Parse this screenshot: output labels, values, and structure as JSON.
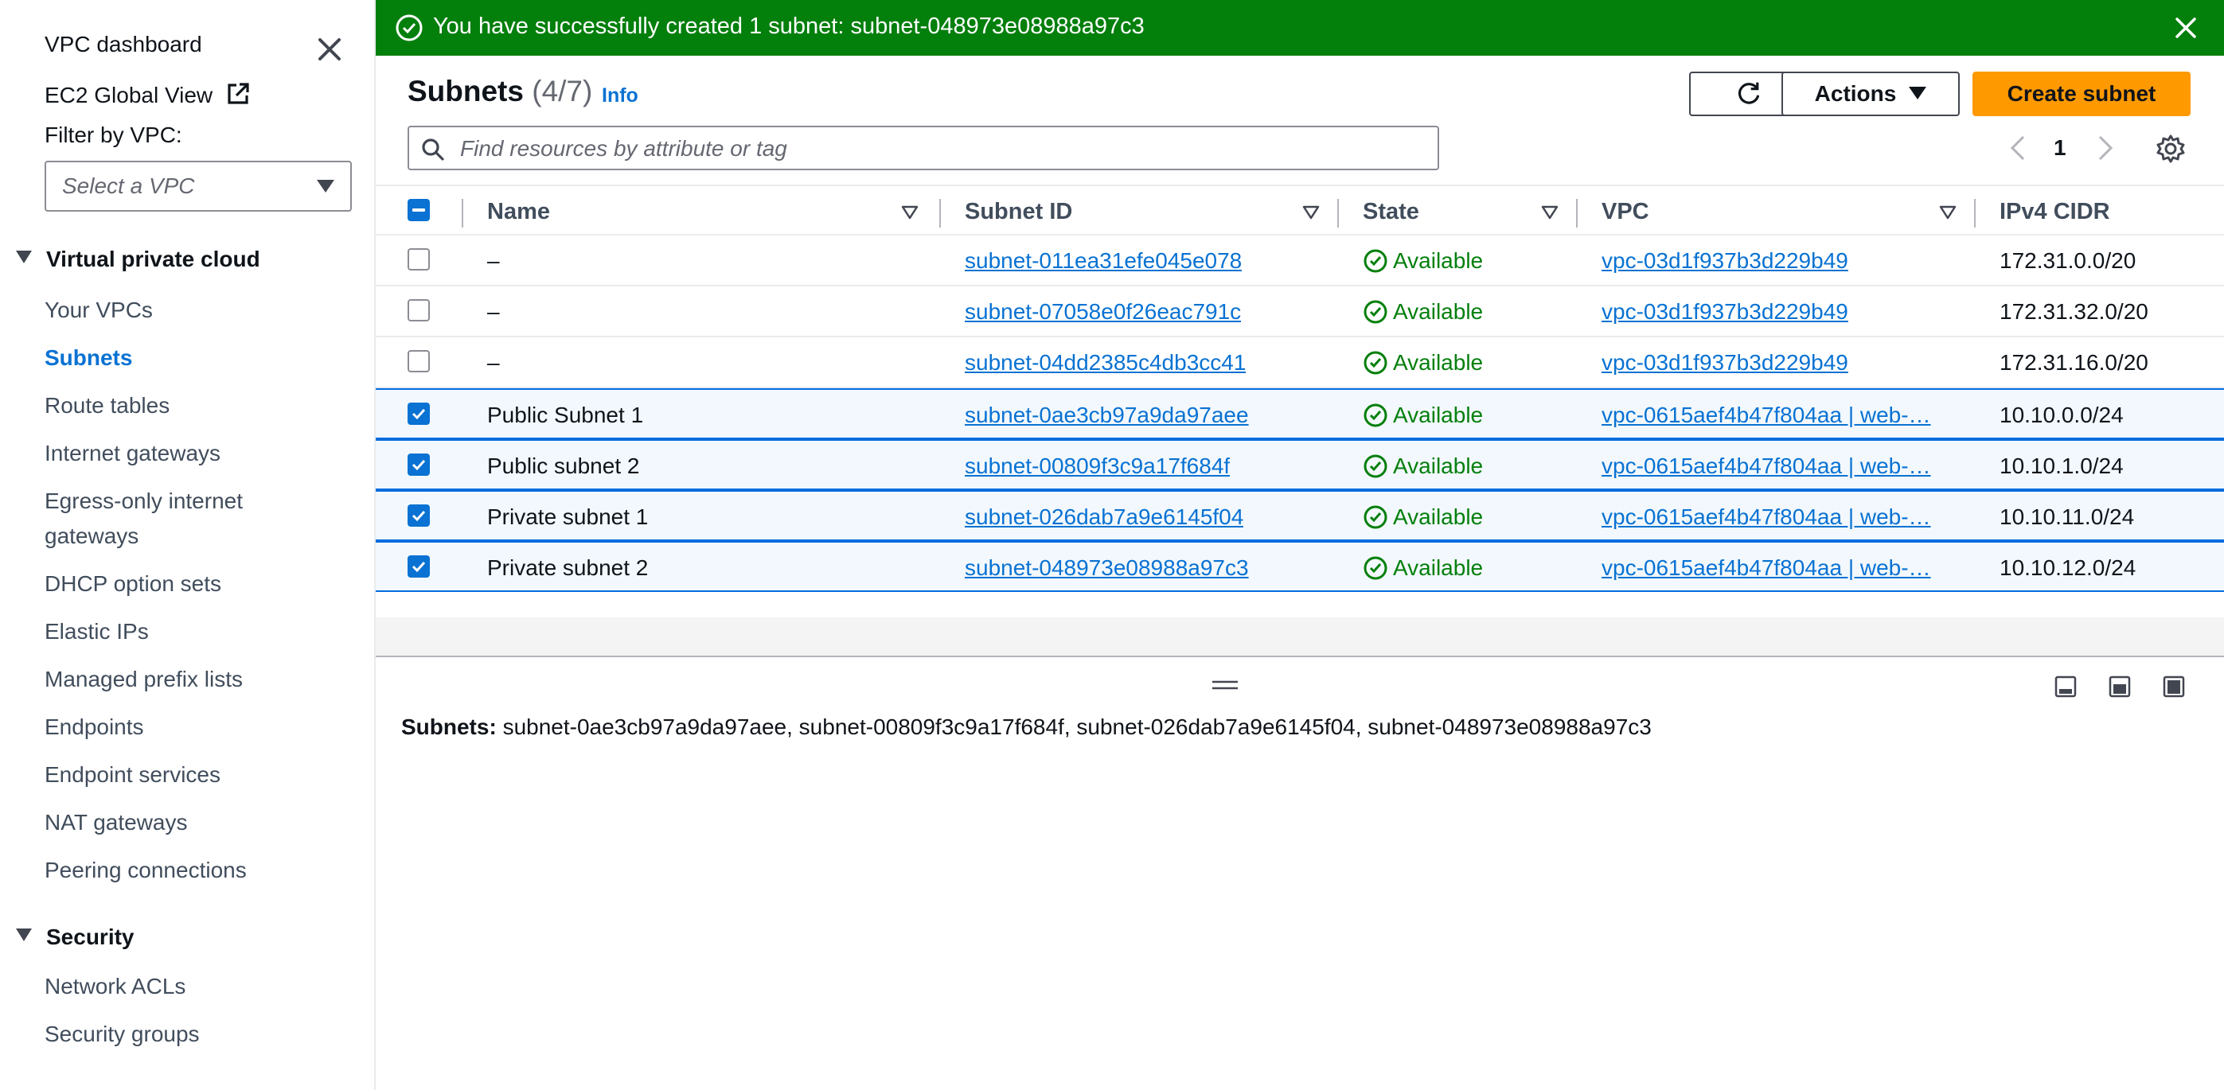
{
  "sidebar": {
    "dashboard": "VPC dashboard",
    "global_view": "EC2 Global View",
    "filter_label": "Filter by VPC:",
    "filter_placeholder": "Select a VPC",
    "sections": [
      {
        "title": "Virtual private cloud",
        "items": [
          "Your VPCs",
          "Subnets",
          "Route tables",
          "Internet gateways",
          "Egress-only internet gateways",
          "DHCP option sets",
          "Elastic IPs",
          "Managed prefix lists",
          "Endpoints",
          "Endpoint services",
          "NAT gateways",
          "Peering connections"
        ],
        "active": "Subnets"
      },
      {
        "title": "Security",
        "items": [
          "Network ACLs",
          "Security groups"
        ]
      }
    ]
  },
  "flash": {
    "message": "You have successfully created 1 subnet: subnet-048973e08988a97c3",
    "type": "success"
  },
  "header": {
    "title": "Subnets",
    "count": "(4/7)",
    "info": "Info",
    "actions": "Actions",
    "create": "Create subnet"
  },
  "search": {
    "placeholder": "Find resources by attribute or tag",
    "value": ""
  },
  "pagination": {
    "page": "1"
  },
  "table": {
    "columns": [
      "Name",
      "Subnet ID",
      "State",
      "VPC",
      "IPv4 CIDR"
    ],
    "rows": [
      {
        "name": "–",
        "subnet_id": "subnet-011ea31efe045e078",
        "state": "Available",
        "vpc": "vpc-03d1f937b3d229b49",
        "cidr": "172.31.0.0/20",
        "selected": false
      },
      {
        "name": "–",
        "subnet_id": "subnet-07058e0f26eac791c",
        "state": "Available",
        "vpc": "vpc-03d1f937b3d229b49",
        "cidr": "172.31.32.0/20",
        "selected": false
      },
      {
        "name": "–",
        "subnet_id": "subnet-04dd2385c4db3cc41",
        "state": "Available",
        "vpc": "vpc-03d1f937b3d229b49",
        "cidr": "172.31.16.0/20",
        "selected": false
      },
      {
        "name": "Public Subnet 1",
        "subnet_id": "subnet-0ae3cb97a9da97aee",
        "state": "Available",
        "vpc": "vpc-0615aef4b47f804aa | web-…",
        "cidr": "10.10.0.0/24",
        "selected": true
      },
      {
        "name": "Public subnet 2",
        "subnet_id": "subnet-00809f3c9a17f684f",
        "state": "Available",
        "vpc": "vpc-0615aef4b47f804aa | web-…",
        "cidr": "10.10.1.0/24",
        "selected": true
      },
      {
        "name": "Private subnet 1",
        "subnet_id": "subnet-026dab7a9e6145f04",
        "state": "Available",
        "vpc": "vpc-0615aef4b47f804aa | web-…",
        "cidr": "10.10.11.0/24",
        "selected": true
      },
      {
        "name": "Private subnet 2",
        "subnet_id": "subnet-048973e08988a97c3",
        "state": "Available",
        "vpc": "vpc-0615aef4b47f804aa | web-…",
        "cidr": "10.10.12.0/24",
        "selected": true
      }
    ]
  },
  "split_panel": {
    "label": "Subnets:",
    "value": "subnet-0ae3cb97a9da97aee, subnet-00809f3c9a17f684f, subnet-026dab7a9e6145f04, subnet-048973e08988a97c3"
  },
  "colors": {
    "success": "#037f0c",
    "link": "#0972d3",
    "primary": "#ff9900",
    "selected_row": "#f2f8fd"
  }
}
